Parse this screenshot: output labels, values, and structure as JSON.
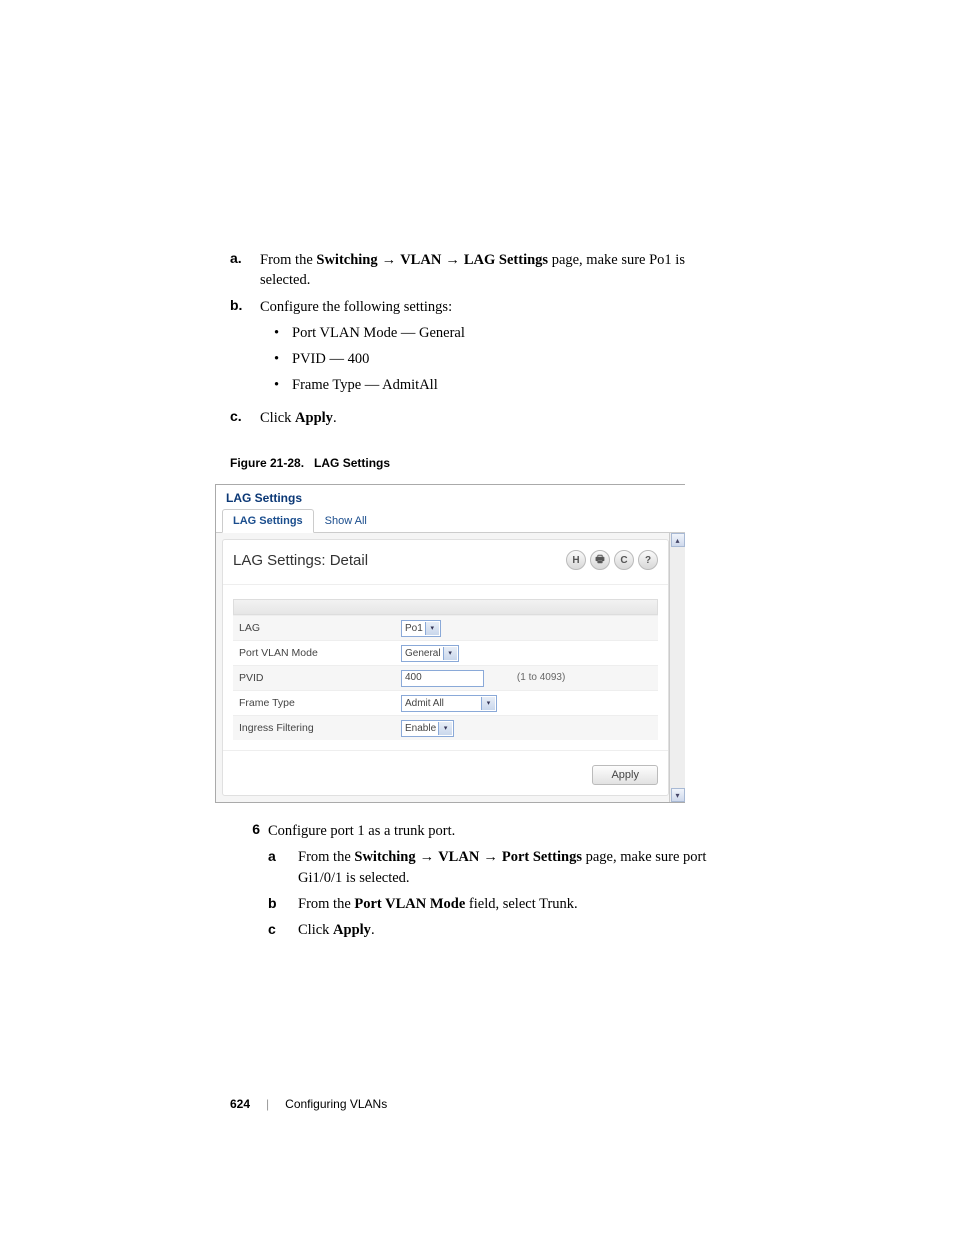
{
  "steps_top": {
    "a": {
      "marker": "a.",
      "text_pre": "From the ",
      "bold1": "Switching",
      "arrow": " → ",
      "bold2": "VLAN",
      "bold3": "LAG Settings",
      "text_post": " page, make sure Po1 is selected."
    },
    "b": {
      "marker": "b.",
      "text": "Configure the following settings:",
      "bullets": [
        "Port VLAN Mode — General",
        "PVID — 400",
        "Frame Type — AdmitAll"
      ]
    },
    "c": {
      "marker": "c.",
      "text_pre": "Click ",
      "bold": "Apply",
      "text_post": "."
    }
  },
  "figure": {
    "label": "Figure 21-28.",
    "title": "LAG Settings"
  },
  "screenshot": {
    "window_title": "LAG Settings",
    "tabs": {
      "active": "LAG Settings",
      "other": "Show All"
    },
    "panel_title": "LAG Settings: Detail",
    "icons": [
      "H",
      "🖶",
      "C",
      "?"
    ],
    "rows": {
      "lag": {
        "label": "LAG",
        "value": "Po1"
      },
      "mode": {
        "label": "Port VLAN Mode",
        "value": "General"
      },
      "pvid": {
        "label": "PVID",
        "value": "400",
        "hint": "(1 to 4093)"
      },
      "frame": {
        "label": "Frame Type",
        "value": "Admit All"
      },
      "ingress": {
        "label": "Ingress Filtering",
        "value": "Enable"
      }
    },
    "apply": "Apply"
  },
  "step6": {
    "num": "6",
    "intro": "Configure port 1 as a trunk port.",
    "a": {
      "marker": "a",
      "text_pre": "From the ",
      "bold1": "Switching",
      "arrow": " → ",
      "bold2": "VLAN",
      "bold3": "Port Settings",
      "text_post": " page, make sure port Gi1/0/1 is selected."
    },
    "b": {
      "marker": "b",
      "text_pre": "From the ",
      "bold": "Port VLAN Mode",
      "text_post": " field, select Trunk."
    },
    "c": {
      "marker": "c",
      "text_pre": "Click ",
      "bold": "Apply",
      "text_post": "."
    }
  },
  "footer": {
    "page": "624",
    "section": "Configuring VLANs"
  }
}
